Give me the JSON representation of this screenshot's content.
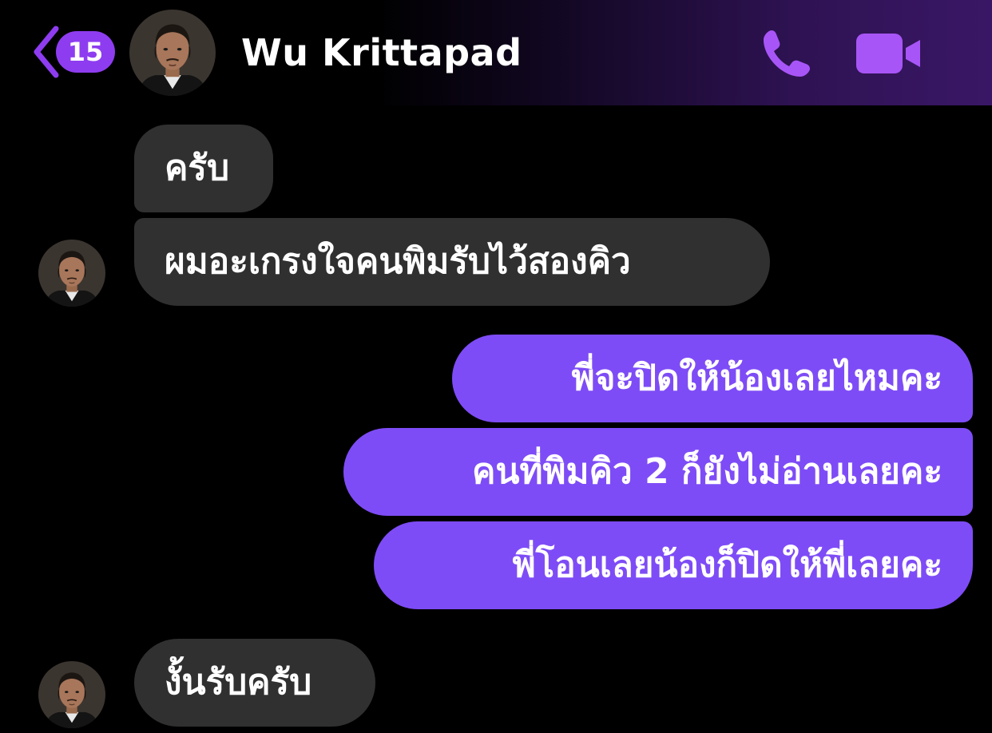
{
  "header": {
    "back_count": "15",
    "contact_name": "Wu Krittapad",
    "accent_color": "#8e3cf0"
  },
  "messages": [
    {
      "direction": "incoming",
      "text": "ครับ"
    },
    {
      "direction": "incoming",
      "text": "ผมอะเกรงใจคนพิมรับไว้สองคิว"
    },
    {
      "direction": "outgoing",
      "text": "พี่จะปิดให้น้องเลยไหมคะ"
    },
    {
      "direction": "outgoing",
      "text": "คนที่พิมคิว 2 ก็ยังไม่อ่านเลยคะ"
    },
    {
      "direction": "outgoing",
      "text": "พี่โอนเลยน้องก็ปิดให้พี่เลยคะ"
    },
    {
      "direction": "incoming",
      "text": "งั้นรับครับ"
    }
  ],
  "icons": {
    "back": "chevron-left-icon",
    "call": "phone-icon",
    "video": "video-camera-icon"
  },
  "colors": {
    "incoming_bubble": "#303030",
    "outgoing_bubble": "#7e4cf6",
    "background": "#000000"
  }
}
